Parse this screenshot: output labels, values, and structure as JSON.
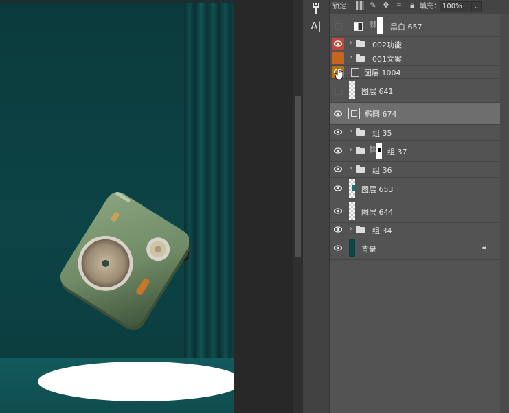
{
  "lock_bar": {
    "label": "锁定：",
    "fill_label": "填充：",
    "fill_value": "100%",
    "icons": [
      "checkerboard-lock-icon",
      "brush-lock-icon",
      "move-lock-icon",
      "artboard-lock-icon",
      "padlock-icon"
    ]
  },
  "tools": [
    "puppet-warp-tool-icon",
    "type-tool-icon"
  ],
  "tool_labels": {
    "type": "A|"
  },
  "layers": [
    {
      "name": "黑白 657",
      "kind": "adjustment",
      "visible": false
    },
    {
      "name": "002功能",
      "kind": "group",
      "visible": true,
      "color_tag": "#c0493f"
    },
    {
      "name": "001文案",
      "kind": "group",
      "visible": false,
      "color_tag": "#c8641e"
    },
    {
      "name": "图层 1004",
      "kind": "smart-object",
      "visible": true,
      "color_tag": "#b8730e"
    },
    {
      "name": "图层 641",
      "kind": "pixel",
      "visible": false
    },
    {
      "name": "椭圆 674",
      "kind": "shape",
      "visible": true,
      "selected": true
    },
    {
      "name": "组 35",
      "kind": "group",
      "visible": true
    },
    {
      "name": "组 37",
      "kind": "group-masked",
      "visible": true
    },
    {
      "name": "组 36",
      "kind": "group",
      "visible": true
    },
    {
      "name": "图层 653",
      "kind": "pixel",
      "visible": true
    },
    {
      "name": "图层 644",
      "kind": "pixel",
      "visible": true
    },
    {
      "name": "组 34",
      "kind": "group",
      "visible": true
    },
    {
      "name": "背景",
      "kind": "background",
      "visible": true,
      "locked": true
    }
  ],
  "colors": {
    "canvas_teal": "#0d4446",
    "spotlight": "#ffffff",
    "radio_green": "#6f8a66",
    "panel_bg": "#535353",
    "selected_row": "#6e6e6e"
  }
}
